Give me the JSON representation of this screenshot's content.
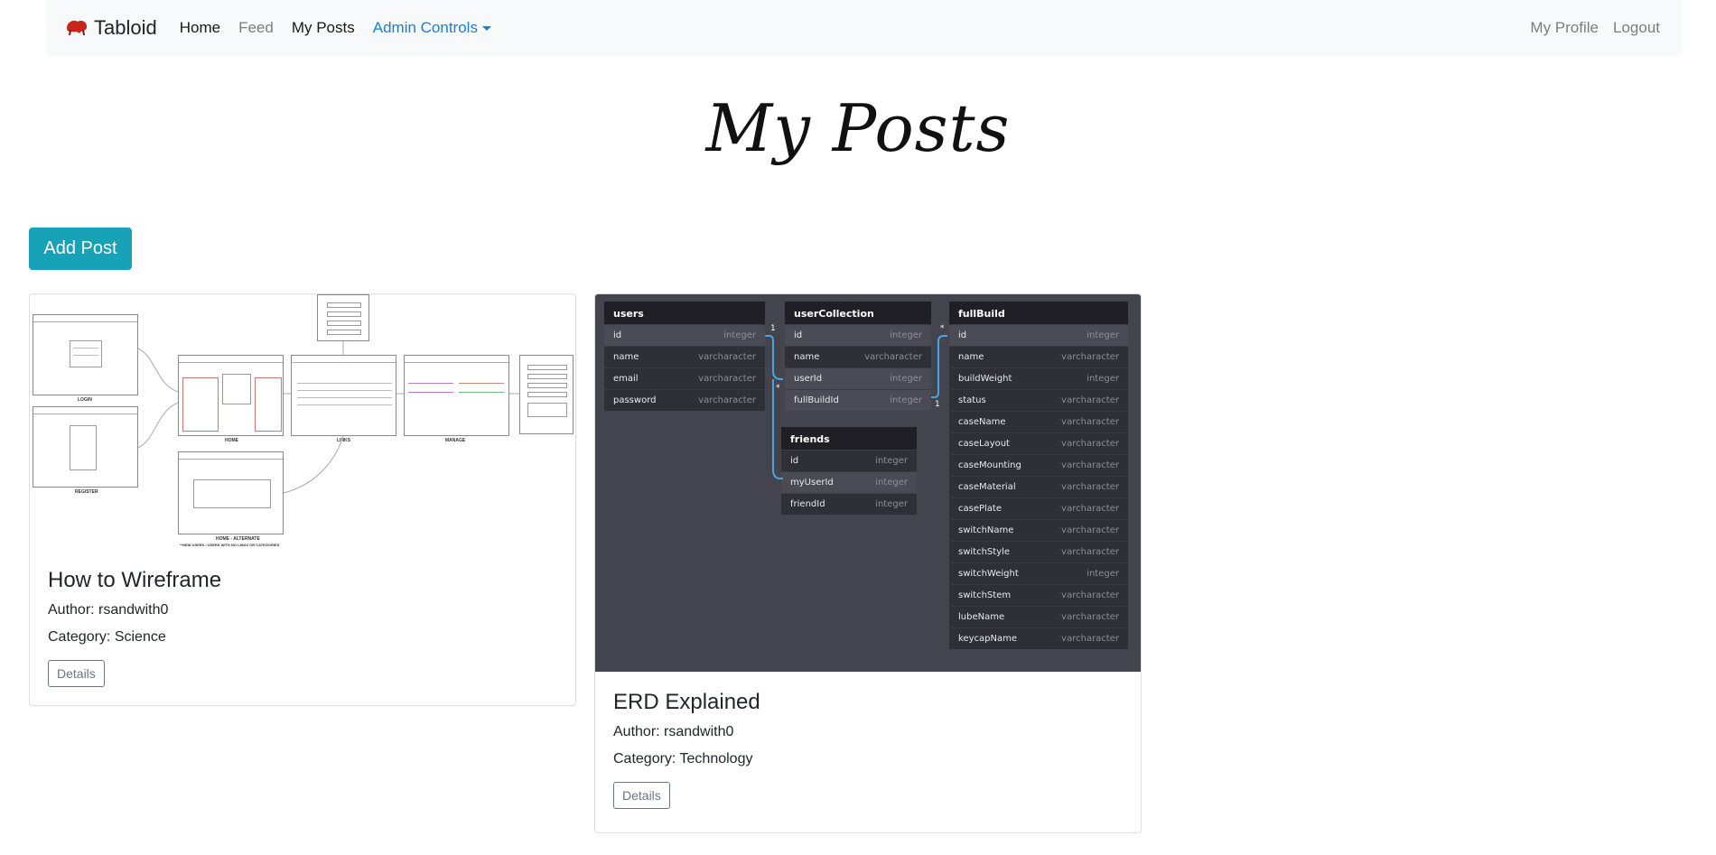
{
  "nav": {
    "brand": "Tabloid",
    "links": [
      "Home",
      "Feed",
      "My Posts"
    ],
    "admin": "Admin Controls",
    "right": [
      "My Profile",
      "Logout"
    ]
  },
  "page": {
    "title": "My Posts",
    "add_post": "Add Post"
  },
  "posts": [
    {
      "title": "How to Wireframe",
      "author": "Author: rsandwith0",
      "category": "Category: Science",
      "details": "Details",
      "image_labels": [
        "LOGIN",
        "REGISTER",
        "HOME",
        "LINKS",
        "MANAGE",
        "HOME - ALTERNATE",
        "**NEW USERS / USERS WITH NO LINKS OR CATEGORIES"
      ]
    },
    {
      "title": "ERD Explained",
      "author": "Author: rsandwith0",
      "category": "Category: Technology",
      "details": "Details",
      "erd": {
        "tables": [
          {
            "name": "users",
            "fields": [
              [
                "id",
                "integer"
              ],
              [
                "name",
                "varcharacter"
              ],
              [
                "email",
                "varcharacter"
              ],
              [
                "password",
                "varcharacter"
              ]
            ]
          },
          {
            "name": "userCollection",
            "fields": [
              [
                "id",
                "integer"
              ],
              [
                "name",
                "varcharacter"
              ],
              [
                "userId",
                "integer"
              ],
              [
                "fullBuildId",
                "integer"
              ]
            ]
          },
          {
            "name": "friends",
            "fields": [
              [
                "id",
                "integer"
              ],
              [
                "myUserId",
                "integer"
              ],
              [
                "friendId",
                "integer"
              ]
            ]
          },
          {
            "name": "fullBuild",
            "fields": [
              [
                "id",
                "integer"
              ],
              [
                "name",
                "varcharacter"
              ],
              [
                "buildWeight",
                "integer"
              ],
              [
                "status",
                "varcharacter"
              ],
              [
                "caseName",
                "varcharacter"
              ],
              [
                "caseLayout",
                "varcharacter"
              ],
              [
                "caseMounting",
                "varcharacter"
              ],
              [
                "caseMaterial",
                "varcharacter"
              ],
              [
                "casePlate",
                "varcharacter"
              ],
              [
                "switchName",
                "varcharacter"
              ],
              [
                "switchStyle",
                "varcharacter"
              ],
              [
                "switchWeight",
                "integer"
              ],
              [
                "switchStem",
                "varcharacter"
              ],
              [
                "lubeName",
                "varcharacter"
              ],
              [
                "keycapName",
                "varcharacter"
              ]
            ]
          }
        ],
        "cardinality": [
          "1",
          "*",
          "1",
          "*"
        ]
      }
    }
  ],
  "colors": {
    "accent": "#17a2b8",
    "admin_link": "#1a80d0",
    "navbar_bg": "#f8f9fa",
    "erd_bg": "#44444f",
    "erd_link": "#4aa3df"
  }
}
